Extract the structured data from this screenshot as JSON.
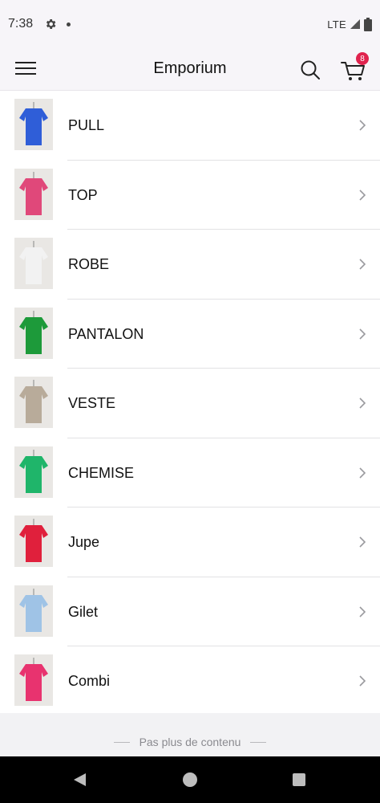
{
  "status_bar": {
    "time": "7:38",
    "network": "LTE"
  },
  "app_bar": {
    "title": "Emporium",
    "cart_count": "8"
  },
  "categories": [
    {
      "label": "PULL",
      "color": "#2f5ed8"
    },
    {
      "label": "TOP",
      "color": "#e0487a"
    },
    {
      "label": "ROBE",
      "color": "#f2f2f2"
    },
    {
      "label": "PANTALON",
      "color": "#1d9a3a"
    },
    {
      "label": "VESTE",
      "color": "#b8ab9a"
    },
    {
      "label": "CHEMISE",
      "color": "#1fb56a"
    },
    {
      "label": "Jupe",
      "color": "#e0203c"
    },
    {
      "label": "Gilet",
      "color": "#9fc3e6"
    },
    {
      "label": "Combi",
      "color": "#e8336f"
    }
  ],
  "footer": {
    "text": "Pas plus de contenu"
  },
  "colors": {
    "badge": "#e0234e",
    "app_bar_bg": "#f7f5f9"
  }
}
